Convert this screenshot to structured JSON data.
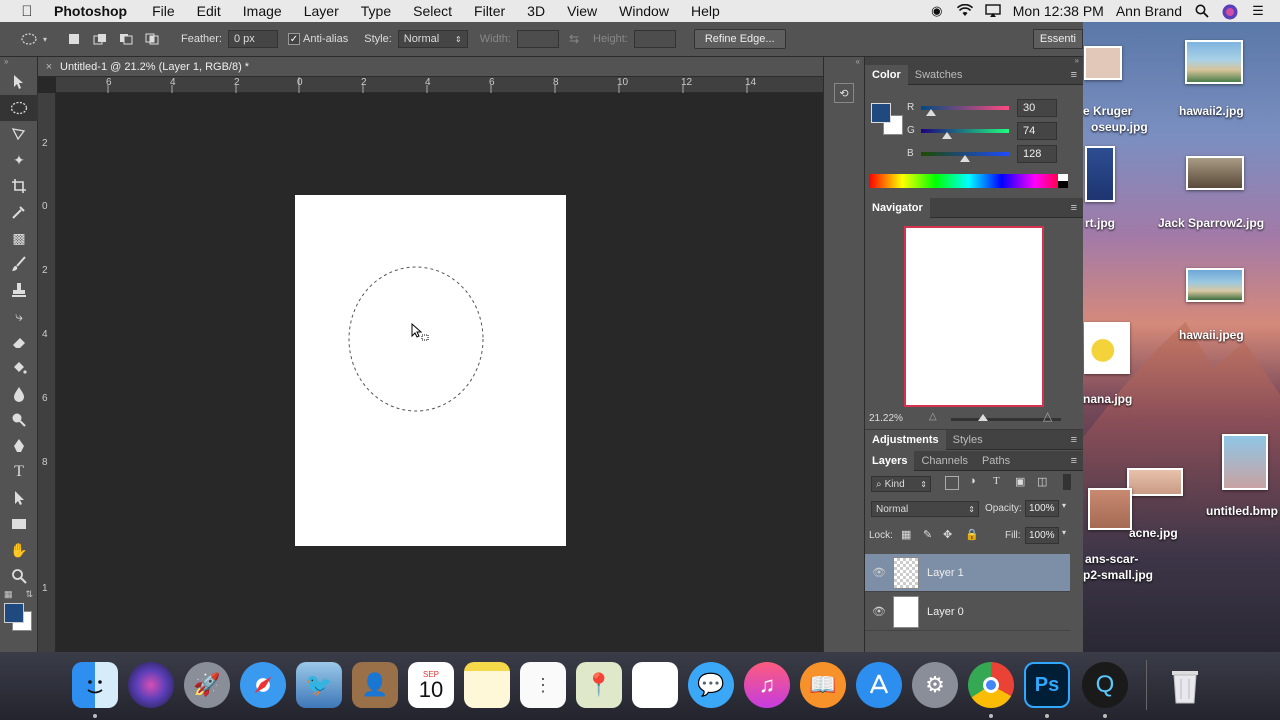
{
  "menubar": {
    "app_name": "Photoshop",
    "items": [
      "File",
      "Edit",
      "Image",
      "Layer",
      "Type",
      "Select",
      "Filter",
      "3D",
      "View",
      "Window",
      "Help"
    ],
    "clock": "Mon 12:38 PM",
    "user": "Ann Brand"
  },
  "options": {
    "feather_label": "Feather:",
    "feather_value": "0 px",
    "antialias_label": "Anti-alias",
    "style_label": "Style:",
    "style_value": "Normal",
    "width_label": "Width:",
    "height_label": "Height:",
    "refine_label": "Refine Edge...",
    "workspace_label": "Essenti"
  },
  "document": {
    "tab_title": "Untitled-1 @ 21.2% (Layer 1, RGB/8) *",
    "close_glyph": "×",
    "ruler_top": [
      "6",
      "4",
      "2",
      "0",
      "2",
      "4",
      "6",
      "8",
      "10",
      "12",
      "14"
    ],
    "ruler_left": [
      "2",
      "0",
      "2",
      "4",
      "6",
      "8",
      "1"
    ]
  },
  "color_panel": {
    "tabs": [
      "Color",
      "Swatches"
    ],
    "r_label": "R",
    "g_label": "G",
    "b_label": "B",
    "r_value": "30",
    "g_value": "74",
    "b_value": "128",
    "foreground": "#1e4a80"
  },
  "navigator": {
    "title": "Navigator",
    "zoom": "21.22%"
  },
  "adjustments": {
    "tabs": [
      "Adjustments",
      "Styles"
    ]
  },
  "layers_panel": {
    "tabs": [
      "Layers",
      "Channels",
      "Paths"
    ],
    "kind_label": "Kind",
    "blend_mode": "Normal",
    "opacity_label": "Opacity:",
    "opacity_value": "100%",
    "lock_label": "Lock:",
    "fill_label": "Fill:",
    "fill_value": "100%",
    "layers": [
      {
        "name": "Layer 1",
        "selected": true
      },
      {
        "name": "Layer 0",
        "selected": false
      }
    ]
  },
  "desktop": {
    "files": [
      "e Kruger",
      "oseup.jpg",
      "hawaii2.jpg",
      "rt.jpg",
      "Jack Sparrow2.jpg",
      "hawaii.jpeg",
      "nana.jpg",
      "acne.jpg",
      "untitled.bmp",
      "ans-scar-",
      "p2-small.jpg"
    ]
  },
  "dock": {
    "calendar_month": "SEP",
    "calendar_day": "10"
  }
}
